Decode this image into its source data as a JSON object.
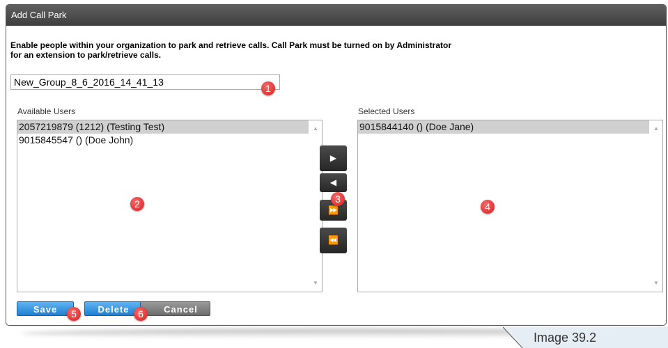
{
  "dialog": {
    "title": "Add Call Park",
    "description_line1": "Enable people within your organization to park and retrieve calls. Call Park must be turned on by Administrator",
    "description_line2": "for an extension to park/retrieve calls.",
    "name_value": "New_Group_8_6_2016_14_41_13"
  },
  "available": {
    "label": "Available Users",
    "items": [
      "2057219879 (1212) (Testing Test)",
      "9015845547 () (Doe John)"
    ]
  },
  "selected": {
    "label": "Selected Users",
    "items": [
      "9015844140 () (Doe Jane)"
    ]
  },
  "move_buttons": {
    "add": "▶",
    "remove": "◀",
    "add_all": "⏩",
    "remove_all": "⏪"
  },
  "actions": {
    "save": "Save",
    "delete": "Delete",
    "cancel": "Cancel"
  },
  "badges": [
    "1",
    "2",
    "3",
    "4",
    "5",
    "6"
  ],
  "caption": "Image 39.2",
  "colors": {
    "titlebar": "#4a4a4a",
    "button_blue": "#2f8fe0",
    "badge_red": "#e03a3a"
  }
}
